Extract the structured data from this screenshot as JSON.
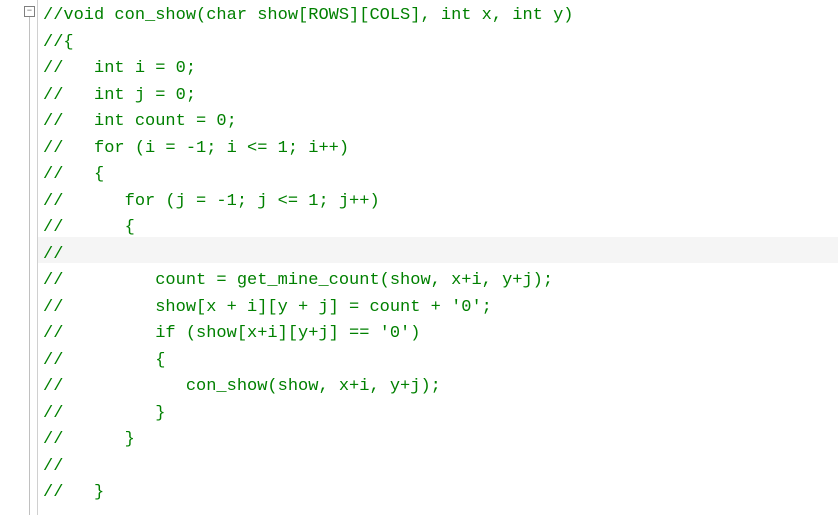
{
  "fold_marker": "−",
  "lines": [
    "//void con_show(char show[ROWS][COLS], int x, int y)",
    "//{",
    "//   int i = 0;",
    "//   int j = 0;",
    "//   int count = 0;",
    "//   for (i = -1; i <= 1; i++)",
    "//   {",
    "//      for (j = -1; j <= 1; j++)",
    "//      {",
    "//",
    "//         count = get_mine_count(show, x+i, y+j);",
    "//         show[x + i][y + j] = count + '0';",
    "//         if (show[x+i][y+j] == '0')",
    "//         {",
    "//            con_show(show, x+i, y+j);",
    "//         }",
    "//      }",
    "//",
    "//   }"
  ]
}
